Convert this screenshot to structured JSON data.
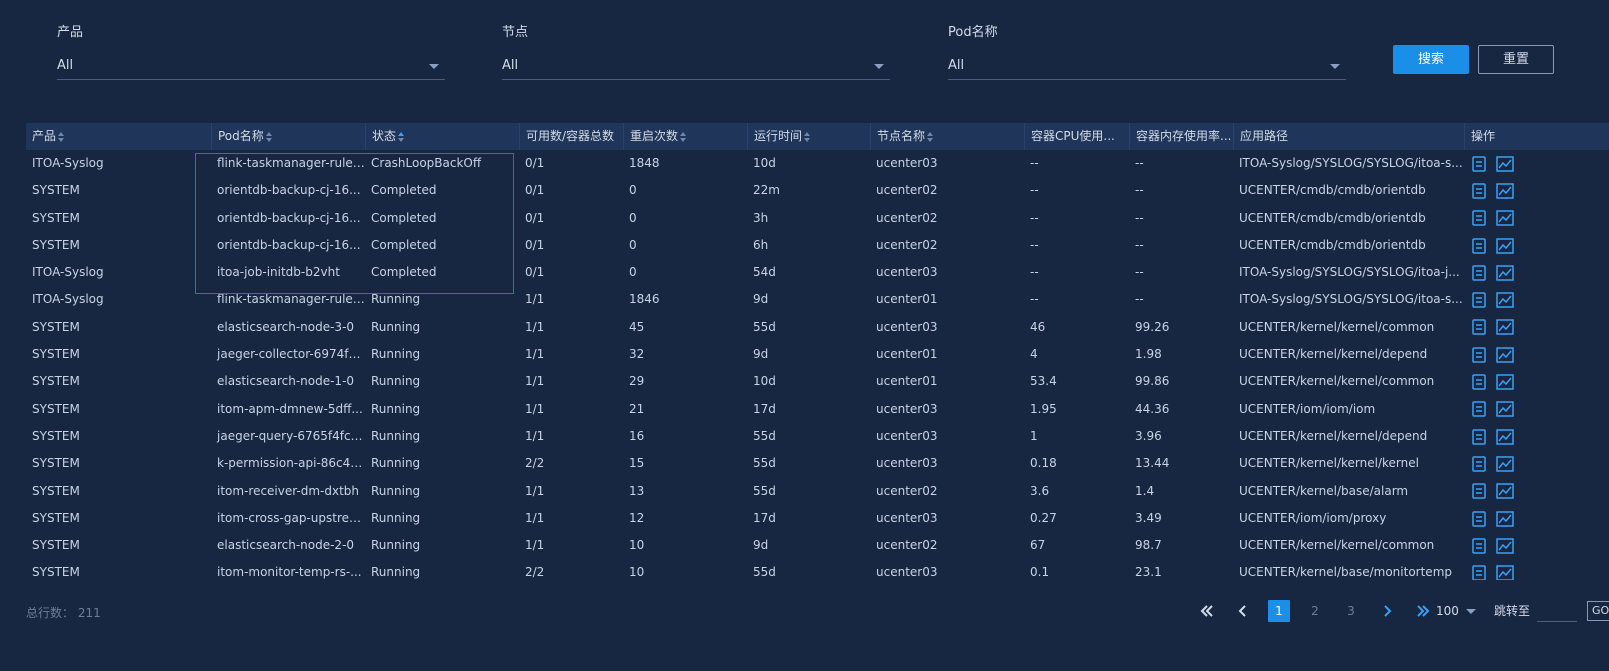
{
  "filters": {
    "product": {
      "label": "产品",
      "value": "All"
    },
    "node": {
      "label": "节点",
      "value": "All"
    },
    "pod": {
      "label": "Pod名称",
      "value": "All"
    }
  },
  "buttons": {
    "search": "搜索",
    "reset": "重置"
  },
  "table": {
    "headers": [
      "产品",
      "Pod名称",
      "状态",
      "可用数/容器总数",
      "重启次数",
      "运行时间",
      "节点名称",
      "容器CPU使用...",
      "容器内存使用率...",
      "应用路径",
      "操作"
    ],
    "rows": [
      [
        "ITOA-Syslog",
        "flink-taskmanager-rule-...",
        "CrashLoopBackOff",
        "0/1",
        "1848",
        "10d",
        "ucenter03",
        "--",
        "--",
        "ITOA-Syslog/SYSLOG/SYSLOG/itoa-s..."
      ],
      [
        "SYSTEM",
        "orientdb-backup-cj-16...",
        "Completed",
        "0/1",
        "0",
        "22m",
        "ucenter02",
        "--",
        "--",
        "UCENTER/cmdb/cmdb/orientdb"
      ],
      [
        "SYSTEM",
        "orientdb-backup-cj-16...",
        "Completed",
        "0/1",
        "0",
        "3h",
        "ucenter02",
        "--",
        "--",
        "UCENTER/cmdb/cmdb/orientdb"
      ],
      [
        "SYSTEM",
        "orientdb-backup-cj-16...",
        "Completed",
        "0/1",
        "0",
        "6h",
        "ucenter02",
        "--",
        "--",
        "UCENTER/cmdb/cmdb/orientdb"
      ],
      [
        "ITOA-Syslog",
        "itoa-job-initdb-b2vht",
        "Completed",
        "0/1",
        "0",
        "54d",
        "ucenter03",
        "--",
        "--",
        "ITOA-Syslog/SYSLOG/SYSLOG/itoa-j..."
      ],
      [
        "ITOA-Syslog",
        "flink-taskmanager-rule-...",
        "Running",
        "1/1",
        "1846",
        "9d",
        "ucenter01",
        "--",
        "--",
        "ITOA-Syslog/SYSLOG/SYSLOG/itoa-s..."
      ],
      [
        "SYSTEM",
        "elasticsearch-node-3-0",
        "Running",
        "1/1",
        "45",
        "55d",
        "ucenter03",
        "46",
        "99.26",
        "UCENTER/kernel/kernel/common"
      ],
      [
        "SYSTEM",
        "jaeger-collector-6974fb...",
        "Running",
        "1/1",
        "32",
        "9d",
        "ucenter01",
        "4",
        "1.98",
        "UCENTER/kernel/kernel/depend"
      ],
      [
        "SYSTEM",
        "elasticsearch-node-1-0",
        "Running",
        "1/1",
        "29",
        "10d",
        "ucenter01",
        "53.4",
        "99.86",
        "UCENTER/kernel/kernel/common"
      ],
      [
        "SYSTEM",
        "itom-apm-dmnew-5dff...",
        "Running",
        "1/1",
        "21",
        "17d",
        "ucenter03",
        "1.95",
        "44.36",
        "UCENTER/iom/iom/iom"
      ],
      [
        "SYSTEM",
        "jaeger-query-6765f4fc-...",
        "Running",
        "1/1",
        "16",
        "55d",
        "ucenter03",
        "1",
        "3.96",
        "UCENTER/kernel/kernel/depend"
      ],
      [
        "SYSTEM",
        "k-permission-api-86c4f...",
        "Running",
        "2/2",
        "15",
        "55d",
        "ucenter03",
        "0.18",
        "13.44",
        "UCENTER/kernel/kernel/kernel"
      ],
      [
        "SYSTEM",
        "itom-receiver-dm-dxtbh",
        "Running",
        "1/1",
        "13",
        "55d",
        "ucenter02",
        "3.6",
        "1.4",
        "UCENTER/kernel/base/alarm"
      ],
      [
        "SYSTEM",
        "itom-cross-gap-upstrea...",
        "Running",
        "1/1",
        "12",
        "17d",
        "ucenter03",
        "0.27",
        "3.49",
        "UCENTER/iom/iom/proxy"
      ],
      [
        "SYSTEM",
        "elasticsearch-node-2-0",
        "Running",
        "1/1",
        "10",
        "9d",
        "ucenter02",
        "67",
        "98.7",
        "UCENTER/kernel/kernel/common"
      ],
      [
        "SYSTEM",
        "itom-monitor-temp-rs-...",
        "Running",
        "2/2",
        "10",
        "55d",
        "ucenter03",
        "0.1",
        "23.1",
        "UCENTER/kernel/base/monitortemp"
      ]
    ]
  },
  "footer": {
    "total": "总行数： 211",
    "pages": [
      "1",
      "2",
      "3"
    ],
    "page_size": "100",
    "jump_label": "跳转至",
    "go": "GO"
  },
  "colors": {
    "accent": "#1b8fe8",
    "background": "#172742",
    "highlight": "#d9342f"
  },
  "icons": [
    "detail-icon",
    "chart-icon",
    "first-page-icon",
    "prev-page-icon",
    "next-page-icon",
    "last-page-icon"
  ]
}
